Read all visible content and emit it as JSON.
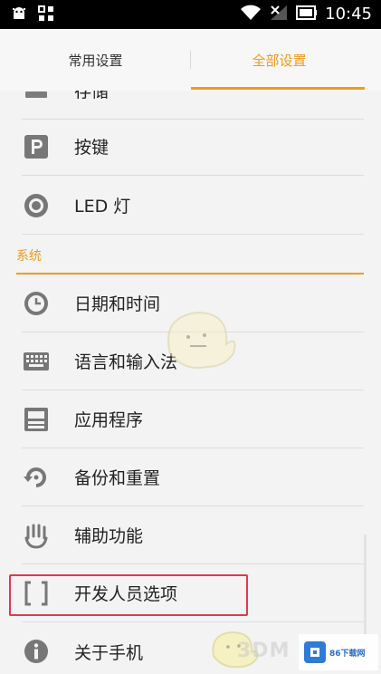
{
  "status_bar": {
    "time": "10:45",
    "icons": [
      "android-debug-icon",
      "app-grid-icon",
      "wifi-icon",
      "no-signal-icon",
      "battery-icon"
    ]
  },
  "tabs": [
    {
      "label": "常用设置",
      "active": false
    },
    {
      "label": "全部设置",
      "active": true
    }
  ],
  "accent_color": "#f09a1a",
  "highlight_color": "#e03a4a",
  "items_top": [
    {
      "label": "存储",
      "icon": "storage-icon"
    },
    {
      "label": "按键",
      "icon": "key-p-icon"
    },
    {
      "label": "LED 灯",
      "icon": "led-light-icon"
    }
  ],
  "section_system": "系统",
  "items_system": [
    {
      "label": "日期和时间",
      "icon": "clock-icon"
    },
    {
      "label": "语言和输入法",
      "icon": "keyboard-icon"
    },
    {
      "label": "应用程序",
      "icon": "apps-icon"
    },
    {
      "label": "备份和重置",
      "icon": "backup-reset-icon"
    },
    {
      "label": "辅助功能",
      "icon": "hand-accessibility-icon"
    },
    {
      "label": "开发人员选项",
      "icon": "developer-brackets-icon"
    },
    {
      "label": "关于手机",
      "icon": "info-icon"
    }
  ],
  "watermarks": {
    "text_3dm": "3DM",
    "site_86": "86下载网"
  }
}
